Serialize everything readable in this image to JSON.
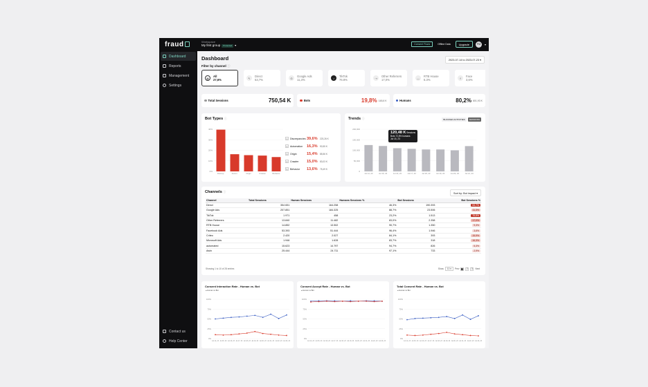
{
  "app": {
    "logo": "fraud"
  },
  "sidebar": {
    "items": [
      {
        "label": "Dashboard",
        "active": true
      },
      {
        "label": "Reports"
      },
      {
        "label": "Management"
      },
      {
        "label": "Settings"
      }
    ],
    "bottom": [
      {
        "label": "Contact us"
      },
      {
        "label": "Help Center"
      }
    ]
  },
  "topbar": {
    "workspace_label": "Workspace",
    "project": "My first group",
    "project_badge": "Protected",
    "btn1": "Consent Flows",
    "btn2": "Offline Data",
    "upgrade": "Upgrade",
    "avatar": "PM"
  },
  "dashboard": {
    "title": "Dashboard",
    "date_range": "2023-07-14 to 2023-07-23",
    "filter_label": "Filter by channel",
    "channels": [
      {
        "name": "All",
        "pct": "27,6%",
        "icon": "grid-icon",
        "active": true
      },
      {
        "name": "Direct",
        "pct": "53,7%",
        "icon": "cursor-icon"
      },
      {
        "name": "Google Ads",
        "pct": "11,3%",
        "icon": "google-icon"
      },
      {
        "name": "TikTok",
        "pct": "76.8%",
        "icon": "tiktok-icon"
      },
      {
        "name": "Other Referrers",
        "pct": "17,0%",
        "icon": "link-icon"
      },
      {
        "name": "RTB House",
        "pct": "5.3%",
        "icon": "rtb-icon"
      },
      {
        "name": "Face",
        "pct": "3,6%",
        "icon": "facebook-icon"
      }
    ],
    "stats": {
      "total": {
        "label": "Total Sessions",
        "value": "750,54 K"
      },
      "bots": {
        "label": "Bots",
        "value": "19,8%",
        "sub": "148,6 K",
        "color": "#d83a2b"
      },
      "humans": {
        "label": "Humans",
        "value": "80,2%",
        "sub": "601,93 K",
        "color": "#3b5fc4"
      }
    }
  },
  "bot_types": {
    "title": "Bot Types",
    "legend": [
      {
        "n": "1",
        "name": "Discrepancies",
        "pct": "39,6%",
        "count": "223,26 K"
      },
      {
        "n": "2",
        "name": "Automation",
        "pct": "16,3%",
        "count": "90,55 K"
      },
      {
        "n": "3",
        "name": "Origin",
        "pct": "15,4%",
        "count": "85,56 K"
      },
      {
        "n": "4",
        "name": "Crawler",
        "pct": "15,0%",
        "count": "83,03 K"
      },
      {
        "n": "5",
        "name": "Behavior",
        "pct": "13,6%",
        "count": "75,49 K"
      }
    ]
  },
  "trends": {
    "title": "Trends",
    "tab1": "BLOCKED ACTIVITIES",
    "tab2": "SESSIONS",
    "tooltip": {
      "value": "120,48 K",
      "unit": "Sessions",
      "detail": "Bots 72,8% humans",
      "date": "Jul 15, 23"
    }
  },
  "channels_table": {
    "title": "Channels",
    "sort": "Sort by: Bot impact",
    "headers": [
      "Channel",
      "Total Sessions",
      "Human Sessions",
      "Humans Sessions %",
      "Bot Sessions",
      "Bot Sessions %"
    ],
    "rows": [
      [
        "Direct",
        "354 651",
        "164.258",
        "46,3%",
        "190.393",
        "53,7%"
      ],
      [
        "Google Ads",
        "207.851",
        "184.325",
        "88,7%",
        "23.506",
        "11,3%"
      ],
      [
        "TikTok",
        "1 971",
        "458",
        "23,2%",
        "1.513",
        "76,8%"
      ],
      [
        "Other Referrers",
        "13.840",
        "11.482",
        "83,0%",
        "2.358",
        "17,0%"
      ],
      [
        "RTB House",
        "14.852",
        "13.502",
        "90,7%",
        "1.350",
        "9,3%"
      ],
      [
        "Facebook Ads",
        "53.393",
        "51.444",
        "96,4%",
        "1.946",
        "3,6%"
      ],
      [
        "Criteo",
        "2.420",
        "2.027",
        "84,1%",
        "393",
        "15,9%"
      ],
      [
        "Microsoft Ads",
        "1.946",
        "1.628",
        "83,7%",
        "318",
        "16,3%"
      ],
      [
        "automated",
        "15.623",
        "14.797",
        "94,7%",
        "826",
        "5,3%"
      ],
      [
        "Awin",
        "25.444",
        "24.711",
        "97,1%",
        "733",
        "2,9%"
      ]
    ],
    "pill_colors": [
      "#c0392b",
      "#f2c6c1",
      "#c0392b",
      "#f0b4ad",
      "#f6d9d6",
      "#f6dddb",
      "#f2c6c1",
      "#f2c6c1",
      "#f6dddb",
      "#f6dddb"
    ],
    "footer": "Showing 1 to 10 of 28 entries",
    "show_label": "Show",
    "show_value": "10",
    "prev": "Prev",
    "pages": [
      "1",
      "2",
      "3"
    ],
    "next": "Next"
  },
  "mini_charts": [
    {
      "title": "Consent Interaction Rate - Human vs. Bot",
      "legend": "Human vs Bot"
    },
    {
      "title": "Consent Accept Rate - Human vs. Bot",
      "legend": "Human vs Bot"
    },
    {
      "title": "Total Consent Rate - Human vs. Bot",
      "legend": "Human vs Bot"
    }
  ],
  "chart_data": [
    {
      "type": "bar",
      "categories": [
        "Discrep.",
        "Autom.",
        "Origin",
        "Crawler",
        "Behavior"
      ],
      "values": [
        39.6,
        16.3,
        15.4,
        15.0,
        13.6
      ],
      "ylim": [
        0,
        40
      ],
      "yticks": [
        "0%",
        "10%",
        "20%",
        "30%",
        "40%"
      ],
      "color": "#d83a2b"
    },
    {
      "type": "bar",
      "categories": [
        "Jul 14, 23",
        "Jul 15, 23",
        "Jul 16, 23",
        "Jul 17, 23",
        "Jul 18, 23",
        "Jul 19, 23",
        "Jul 20, 23",
        "Jul 21, 23"
      ],
      "values": [
        125000,
        120480,
        110000,
        107000,
        104000,
        104000,
        100000,
        120000
      ],
      "ylim": [
        0,
        200000
      ],
      "yticks": [
        "0",
        "50,000",
        "100,000",
        "150,000",
        "200,000"
      ],
      "color": "#b9b9bf"
    },
    {
      "type": "line",
      "x": [
        "Jul 14, 23",
        "Jul 15, 23",
        "Jul 16, 23",
        "Jul 17, 23",
        "Jul 18, 23",
        "Jul 19, 23",
        "Jul 20, 23",
        "Jul 21, 23",
        "Jul 22, 23",
        "Jul 23, 23"
      ],
      "series": [
        {
          "values": [
            50,
            52,
            54,
            55,
            57,
            59,
            54,
            62,
            51,
            60
          ],
          "color": "#3b5fc4"
        },
        {
          "values": [
            10,
            9,
            10,
            12,
            14,
            18,
            13,
            11,
            9,
            8
          ],
          "color": "#d83a2b"
        }
      ],
      "ylim": [
        0,
        100
      ],
      "yticks": [
        "0%",
        "25%",
        "50%",
        "75%",
        "100%"
      ]
    },
    {
      "type": "line",
      "x": [
        "Jul 14, 23",
        "Jul 15, 23",
        "Jul 16, 23",
        "Jul 17, 23",
        "Jul 18, 23",
        "Jul 19, 23",
        "Jul 20, 23",
        "Jul 21, 23",
        "Jul 22, 23",
        "Jul 23, 23"
      ],
      "series": [
        {
          "values": [
            95,
            96,
            96,
            96,
            95,
            96,
            95,
            96,
            96,
            95
          ],
          "color": "#3b5fc4"
        },
        {
          "values": [
            93,
            94,
            95,
            94,
            95,
            94,
            95,
            95,
            94,
            95
          ],
          "color": "#d83a2b"
        }
      ],
      "ylim": [
        0,
        100
      ],
      "yticks": [
        "0%",
        "25%",
        "50%",
        "75%",
        "100%"
      ]
    },
    {
      "type": "line",
      "x": [
        "Jul 14, 23",
        "Jul 15, 23",
        "Jul 16, 23",
        "Jul 17, 23",
        "Jul 18, 23",
        "Jul 19, 23",
        "Jul 20, 23",
        "Jul 21, 23",
        "Jul 22, 23",
        "Jul 23, 23"
      ],
      "series": [
        {
          "values": [
            48,
            51,
            52,
            53,
            54,
            56,
            51,
            60,
            49,
            58
          ],
          "color": "#3b5fc4"
        },
        {
          "values": [
            9,
            8,
            9,
            11,
            13,
            16,
            12,
            10,
            8,
            7
          ],
          "color": "#d83a2b"
        }
      ],
      "ylim": [
        0,
        100
      ],
      "yticks": [
        "0%",
        "25%",
        "50%",
        "75%",
        "100%"
      ]
    }
  ]
}
